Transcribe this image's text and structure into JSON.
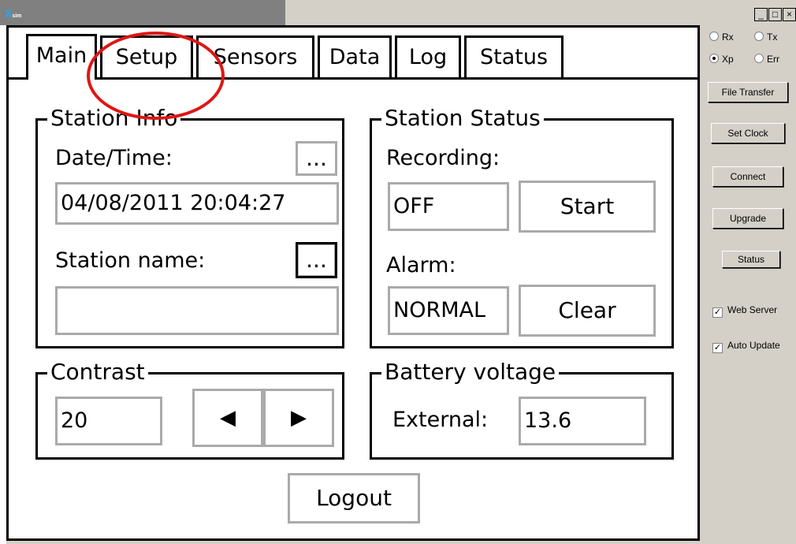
{
  "window": {
    "logo": "X",
    "logo_small": "sim",
    "minimize": "_",
    "maximize": "□",
    "close": "×"
  },
  "tabs": [
    "Main",
    "Setup",
    "Sensors",
    "Data",
    "Log",
    "Status"
  ],
  "station_info": {
    "title": "Station Info",
    "datetime_label": "Date/Time:",
    "datetime_value": "04/08/2011 20:04:27",
    "name_label": "Station name:",
    "name_value": "",
    "ellipsis": "..."
  },
  "station_status": {
    "title": "Station Status",
    "recording_label": "Recording:",
    "recording_value": "OFF",
    "start_label": "Start",
    "alarm_label": "Alarm:",
    "alarm_value": "NORMAL",
    "clear_label": "Clear"
  },
  "contrast": {
    "title": "Contrast",
    "value": "20"
  },
  "battery": {
    "title": "Battery voltage",
    "external_label": "External:",
    "external_value": "13.6"
  },
  "logout_label": "Logout",
  "side": {
    "radios": [
      {
        "label": "Rx",
        "checked": false
      },
      {
        "label": "Tx",
        "checked": false
      },
      {
        "label": "Xp",
        "checked": true
      },
      {
        "label": "Err",
        "checked": false
      }
    ],
    "buttons": [
      "File Transfer",
      "Set Clock",
      "Connect",
      "Upgrade",
      "Status"
    ],
    "checks": [
      {
        "label": "Web Server",
        "checked": true
      },
      {
        "label": "Auto Update",
        "checked": true
      }
    ]
  },
  "colors": {
    "highlight_circle": "#e01515",
    "window_bg": "#d4d0c8"
  }
}
